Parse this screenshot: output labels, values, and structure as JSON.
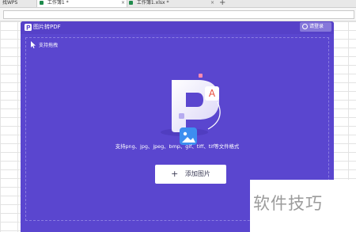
{
  "tabs": [
    {
      "label": "找WPS",
      "active": false
    },
    {
      "label": "工作簿1 *",
      "active": true
    },
    {
      "label": "工作簿1.xlsx *",
      "active": false
    }
  ],
  "app": {
    "title": "图片转PDF",
    "login_label": "请登录",
    "guide_label": "支持拖拽",
    "support_text": "支持png、jpg、jpeg、bmp、gif、tiff、tif等文件格式",
    "add_button_label": "添加图片",
    "accent": "#5a46cf"
  },
  "watermark": {
    "text": "软件技巧"
  }
}
